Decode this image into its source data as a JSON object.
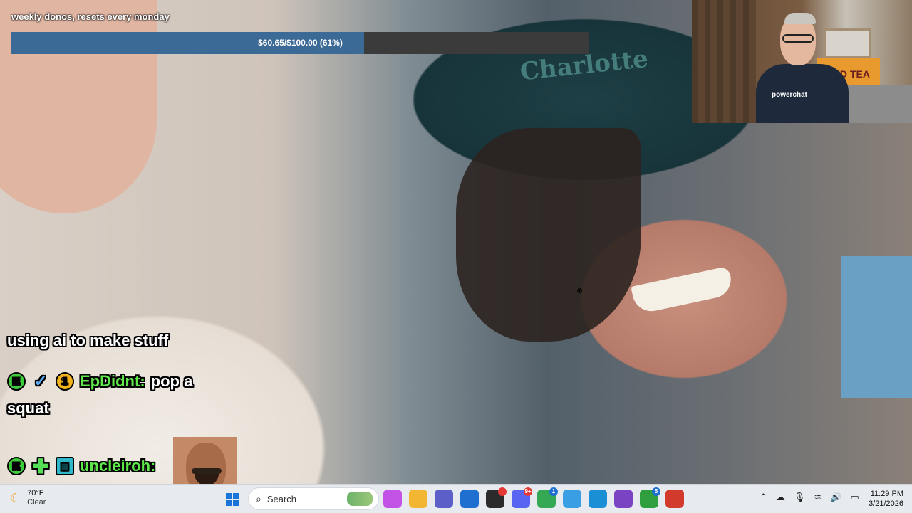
{
  "overlay": {
    "goal_label": "weekly donos, resets every monday",
    "goal_text": "$60.65/$100.00 (61%)",
    "goal_progress": 0.61
  },
  "webcam": {
    "banner_text": "TED TEA",
    "shirt_text": "powerchat"
  },
  "background": {
    "hat_text": "Charlotte"
  },
  "chat": {
    "messages": [
      {
        "text": "using ai to make stuff"
      },
      {
        "badges": [
          "K",
          "check",
          "1"
        ],
        "user": "EpDidnt:",
        "text_a": "pop a",
        "text_b": "squat"
      },
      {
        "badges": [
          "K",
          "plus",
          "grid"
        ],
        "user": "uncleiroh:",
        "emote": "laughing-man-emote"
      }
    ]
  },
  "taskbar": {
    "weather": {
      "temp": "70°F",
      "condition": "Clear",
      "icon": "moon-icon"
    },
    "search_label": "Search",
    "apps": [
      {
        "name": "copilot",
        "color": "#c353e6"
      },
      {
        "name": "file-explorer",
        "color": "#f2b632"
      },
      {
        "name": "teams",
        "color": "#5b5fc7"
      },
      {
        "name": "store",
        "color": "#1f6fd1"
      },
      {
        "name": "obs",
        "color": "#2b2b2b",
        "badge": ""
      },
      {
        "name": "discord",
        "color": "#5865f2",
        "badge": "9+"
      },
      {
        "name": "chrome",
        "color": "#34a853",
        "badge": "1"
      },
      {
        "name": "app-blue",
        "color": "#3a9ee4"
      },
      {
        "name": "edge",
        "color": "#1b8fd6"
      },
      {
        "name": "app-purple",
        "color": "#7a43c4"
      },
      {
        "name": "xbox",
        "color": "#2f9e3f",
        "badge": "5"
      },
      {
        "name": "app-red",
        "color": "#d23b2b"
      }
    ],
    "clock": {
      "time": "11:29 PM",
      "date": "3/21/2026"
    }
  }
}
